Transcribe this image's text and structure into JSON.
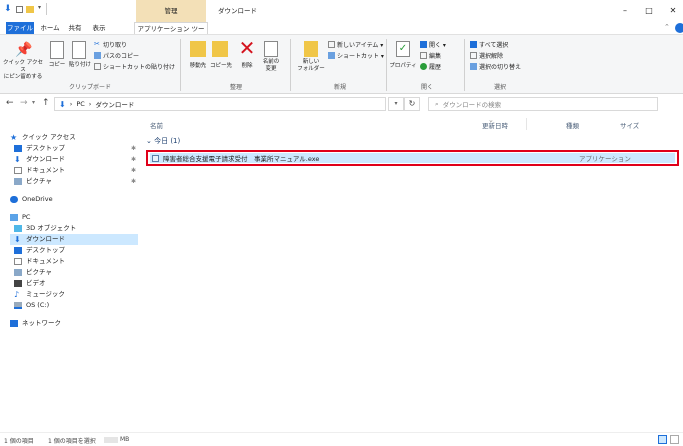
{
  "window": {
    "context_tab": "管理",
    "title": "ダウンロード",
    "controls": [
      "–",
      "□",
      "✕"
    ]
  },
  "tabs": [
    "ファイル",
    "ホーム",
    "共有",
    "表示",
    "アプリケーション ツール"
  ],
  "ribbon": {
    "clipboard": {
      "pin_quick": "クイック アクセス\nにピン留めする",
      "copy": "コピー",
      "paste": "貼り付け",
      "cut": "切り取り",
      "copy_path": "パスのコピー",
      "paste_shortcut": "ショートカットの貼り付け",
      "group": "クリップボード"
    },
    "organize": {
      "move_to": "移動先",
      "copy_to": "コピー先",
      "delete": "削除",
      "rename": "名前の\n変更",
      "group": "整理"
    },
    "new": {
      "new_folder": "新しい\nフォルダー",
      "new_item": "新しいアイテム ▾",
      "shortcut": "ショートカット ▾",
      "group": "新規"
    },
    "open": {
      "properties": "プロパティ",
      "open": "開く ▾",
      "edit": "編集",
      "history": "履歴",
      "group": "開く"
    },
    "select": {
      "select_all": "すべて選択",
      "select_none": "選択解除",
      "invert": "選択の切り替え",
      "group": "選択"
    }
  },
  "address": {
    "back": "←",
    "forward": "→",
    "up": "↑",
    "path": [
      "PC",
      "ダウンロード"
    ],
    "search_placeholder": "ダウンロードの検索"
  },
  "nav": {
    "quick_access": "クイック アクセス",
    "quick_items": [
      "デスクトップ",
      "ダウンロード",
      "ドキュメント",
      "ピクチャ"
    ],
    "onedrive": "OneDrive",
    "pc": "PC",
    "pc_items": [
      "3D オブジェクト",
      "ダウンロード",
      "デスクトップ",
      "ドキュメント",
      "ピクチャ",
      "ビデオ",
      "ミュージック",
      "OS (C:)"
    ],
    "network": "ネットワーク"
  },
  "columns": {
    "name": "名前",
    "date": "更新日時",
    "type": "種類",
    "size": "サイズ"
  },
  "group_header": "今日 (1)",
  "files": [
    {
      "name": "障害者総合支援電子請求受付　事業所マニュアル.exe",
      "date": "",
      "type": "アプリケーション",
      "size": ""
    }
  ],
  "status": {
    "count": "1 個の項目",
    "selected": "1 個の項目を選択",
    "size": "MB"
  },
  "colors": {
    "accent_blue": "#1e6fd9",
    "selection": "#cce8ff",
    "highlight_box": "#e0001a",
    "context_tab_bg": "#f3e0b7"
  }
}
